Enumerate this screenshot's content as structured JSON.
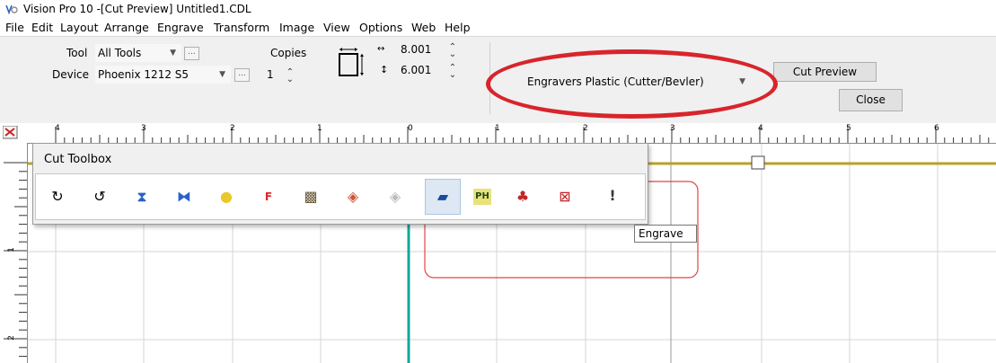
{
  "window": {
    "title": "Vision Pro 10 -[Cut Preview] Untitled1.CDL",
    "app_icon": "vision-pro-icon"
  },
  "menu": [
    "File",
    "Edit",
    "Layout",
    "Arrange",
    "Engrave",
    "Transform",
    "Image",
    "View",
    "Options",
    "Web",
    "Help"
  ],
  "propbar": {
    "tool_label": "Tool",
    "tool_value": "All Tools",
    "device_label": "Device",
    "device_value": "Phoenix 1212 S5",
    "copies_label": "Copies",
    "copies_value": "1",
    "width_value": "8.001",
    "height_value": "6.001",
    "material_value": "Engravers Plastic (Cutter/Bevler)",
    "cut_preview_label": "Cut Preview",
    "close_label": "Close",
    "dots": "..."
  },
  "ruler": {
    "h_labels": [
      "4",
      "3",
      "2",
      "1",
      "0",
      "1",
      "2",
      "3",
      "4",
      "5",
      "6"
    ],
    "v_labels": [
      "1",
      "2"
    ]
  },
  "toolbox": {
    "title": "Cut Toolbox",
    "tooltip": "Engrave",
    "buttons": [
      "rotate-cw-icon",
      "rotate-ccw-icon",
      "flip-vertical-icon",
      "flip-horizontal-icon",
      "light-bulb-icon",
      "font-icon",
      "bitmap-icon",
      "fill-icon",
      "fill-disabled-icon",
      "engrave-icon",
      "ph-icon",
      "cutter-icon",
      "crosshatch-icon",
      "warning-icon"
    ]
  },
  "colors": {
    "highlight_oval": "#d9242c",
    "toolbox_bg": "#f0f0f0",
    "guide_line": "#b8a22a",
    "teal_line": "#14a89a",
    "red_rect": "#e0444a"
  }
}
